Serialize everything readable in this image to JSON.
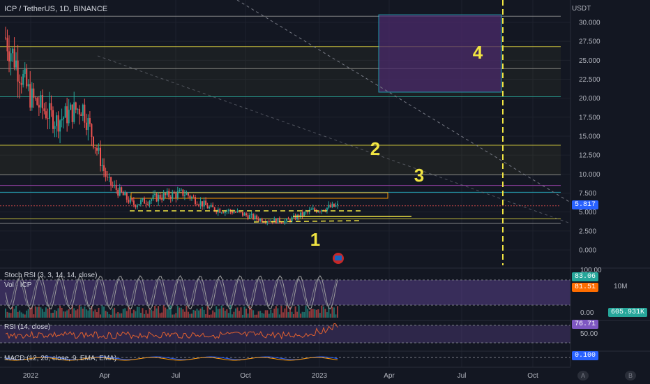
{
  "header": {
    "symbol_line": "ICP / TetherUS, 1D, BINANCE"
  },
  "colors": {
    "background": "#131722",
    "grid": "#1e222d",
    "up": "#26a69a",
    "down": "#ef5350",
    "yellow": "#f0e442",
    "purple": "#7e57c2",
    "cyan": "#26c6da",
    "price_tag": "#2962ff"
  },
  "chart_data": [
    {
      "type": "candlestick",
      "title": "ICP / TetherUS, 1D, BINANCE",
      "ylabel": "USDT",
      "ylim": [
        -2,
        33
      ],
      "y_ticks": [
        "30.000",
        "27.500",
        "25.000",
        "22.500",
        "20.000",
        "17.500",
        "15.000",
        "12.500",
        "10.000",
        "7.500",
        "5.000",
        "2.500",
        "0.000"
      ],
      "x_ticks": [
        "2022",
        "Apr",
        "Jul",
        "Oct",
        "2023",
        "Apr",
        "Jul",
        "Oct"
      ],
      "last_price": "5.817",
      "levels": [
        30.8,
        26.8,
        23.9,
        20.2,
        13.8,
        9.9,
        8.5,
        7.6,
        5.817,
        4.1,
        3.5
      ],
      "zone_box": {
        "from": "Mar 2023",
        "to": "Jul 2023",
        "top": 31.0,
        "bottom": 20.8
      },
      "annotations": [
        "1",
        "2",
        "3",
        "4"
      ],
      "series_approx": [
        {
          "date": "Jan 2022",
          "close": 28
        },
        {
          "date": "Feb 2022",
          "close": 20
        },
        {
          "date": "Mar 2022",
          "close": 17
        },
        {
          "date": "Apr 2022",
          "close": 19
        },
        {
          "date": "May 2022",
          "close": 9
        },
        {
          "date": "Jun 2022",
          "close": 6
        },
        {
          "date": "Jul 2022",
          "close": 7
        },
        {
          "date": "Aug 2022",
          "close": 7.5
        },
        {
          "date": "Sep 2022",
          "close": 5.5
        },
        {
          "date": "Oct 2022",
          "close": 5
        },
        {
          "date": "Nov 2022",
          "close": 4
        },
        {
          "date": "Dec 2022",
          "close": 3.8
        },
        {
          "date": "Jan 2023",
          "close": 5.2
        },
        {
          "date": "Feb 2023",
          "close": 5.8
        }
      ]
    },
    {
      "type": "line",
      "title": "Stoch RSI (3, 3, 14, 14, close)",
      "values": {
        "k": "83.06",
        "d": "81.51"
      },
      "y_ticks": [
        "100.00",
        "0.00"
      ]
    },
    {
      "type": "bar",
      "title": "Vol · ICP",
      "value": "605.931K",
      "y_ticks": [
        "10M"
      ]
    },
    {
      "type": "line",
      "title": "RSI (14, close)",
      "value": "76.71",
      "y_ticks": [
        "50.00"
      ]
    },
    {
      "type": "line",
      "title": "MACD (12, 26, close, 9, EMA, EMA)",
      "value": "0.100"
    }
  ],
  "pane_labels": {
    "stoch": "Stoch RSI (3, 3, 14, 14, close)",
    "vol": "Vol · ICP",
    "rsi": "RSI (14, close)",
    "macd": "MACD (12, 26, close, 9, EMA, EMA)"
  },
  "tags": {
    "price": "5.817",
    "stoch_k": "83.06",
    "stoch_d": "81.51",
    "vol": "605.931K",
    "vol_scale": "10M",
    "rsi": "76.71",
    "macd": "0.100",
    "stoch_top": "100.00",
    "stoch_bot": "0.00",
    "rsi_mid": "50.00",
    "usdt": "USDT"
  },
  "bottom_buttons": {
    "a": "A",
    "b": "B"
  }
}
